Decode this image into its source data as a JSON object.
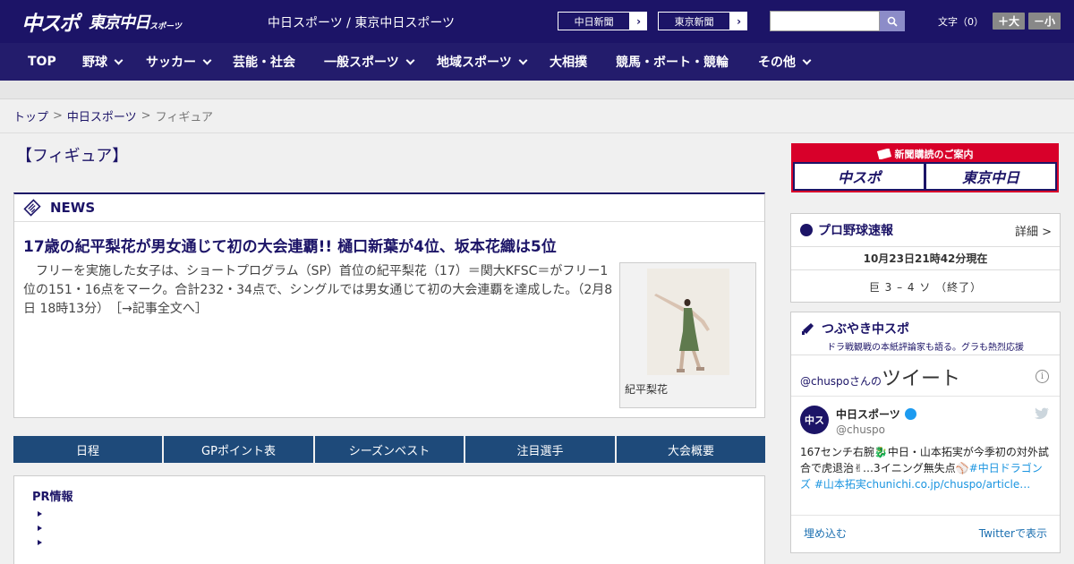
{
  "header": {
    "logo_main": "中スポ",
    "logo_sub": "東京中日",
    "logo_small": "スポーツ",
    "site_title": "中日スポーツ / 東京中日スポーツ",
    "paper_buttons": [
      "中日新聞",
      "東京新聞"
    ],
    "search_placeholder": "",
    "font_label": "文字（0）",
    "font_larger": "＋大",
    "font_smaller": "－小"
  },
  "nav": {
    "items": [
      "TOP",
      "野球",
      "サッカー",
      "芸能・社会",
      "一般スポーツ",
      "地域スポーツ",
      "大相撲",
      "競馬・ボート・競輪",
      "その他"
    ]
  },
  "breadcrumb": {
    "items": [
      "トップ",
      "中日スポーツ",
      "フィギュア"
    ],
    "separator": ">"
  },
  "page_title": "【フィギュア】",
  "news": {
    "heading": "NEWS",
    "title": "17歳の紀平梨花が男女通じて初の大会連覇!! 樋口新葉が4位、坂本花織は5位",
    "body": "フリーを実施した女子は、ショートプログラム（SP）首位の紀平梨花（17）＝関大KFSC＝がフリー1位の151・16点をマーク。合計232・34点で、シングルでは男女通じて初の大会連覇を達成した。（2月8日 18時13分）",
    "more": "［→記事全文へ］",
    "photo_caption": "紀平梨花"
  },
  "tabs": [
    "日程",
    "GPポイント表",
    "シーズンベスト",
    "注目選手",
    "大会概要"
  ],
  "pr": {
    "title": "PR情報",
    "items": [
      "",
      "",
      ""
    ]
  },
  "ad": {
    "top": "新聞購読のご案内",
    "logo_left": "中スポ",
    "logo_right": "東京中日"
  },
  "baseball": {
    "title": "プロ野球速報",
    "more": "詳細 >",
    "time": "10月23日21時42分現在",
    "score": "巨 3 – 4 ソ （終了）"
  },
  "tweets": {
    "title": "つぶやき中スポ",
    "subtitle": "ドラ戦観戦の本紙評論家も語る。グラも熱烈応援",
    "handle_prefix": "@chuspo",
    "handle_suffix": "さんの",
    "tweet_word": "ツイート",
    "info": "i",
    "account_name": "中日スポーツ",
    "account_handle": "@chuspo",
    "avatar_text": "中ス",
    "text_plain": "167センチ右腕🐉中日・山本拓実が今季初の対外試合で虎退治✌…3イニング無失点⚾",
    "text_tags": "#中日ドラゴンズ #山本拓実chunichi.co.jp/chuspo/article…",
    "embed": "埋め込む",
    "view_on_twitter": "Twitterで表示"
  },
  "colors": {
    "navy": "#1c1467",
    "tab_blue": "#1e4a7a",
    "red": "#d8002a"
  }
}
